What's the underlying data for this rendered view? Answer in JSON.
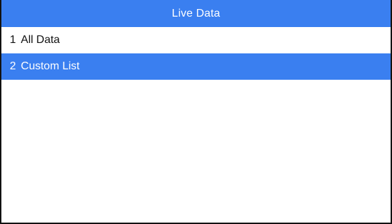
{
  "colors": {
    "accent": "#3a7ff0",
    "text": "#111111",
    "selected_text": "#ffffff",
    "background": "#ffffff"
  },
  "header": {
    "title": "Live Data"
  },
  "menu": {
    "selected_index": 1,
    "items": [
      {
        "number": "1",
        "label": "All Data"
      },
      {
        "number": "2",
        "label": "Custom List"
      }
    ]
  }
}
